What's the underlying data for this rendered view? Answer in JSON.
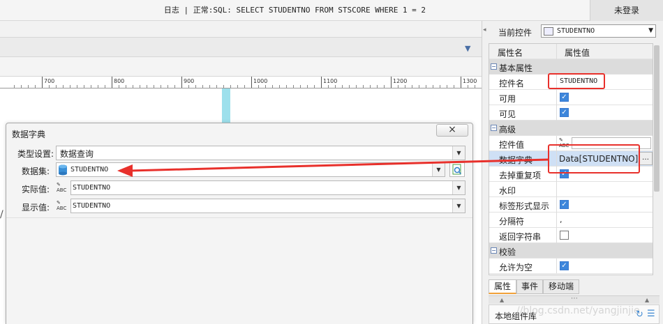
{
  "topbar": {
    "log": "日志 | 正常:SQL: SELECT STUDENTNO FROM STSCORE WHERE 1 = 2",
    "login": "未登录"
  },
  "ruler": {
    "labels": [
      "700",
      "800",
      "900",
      "1000",
      "1100",
      "1200",
      "1300"
    ]
  },
  "dialog": {
    "title": "数据字典",
    "close_icon": "close-icon",
    "type_label": "类型设置:",
    "type_value": "数据查询",
    "dataset_label": "数据集:",
    "dataset_value": "STUDENTNO",
    "actual_label": "实际值:",
    "actual_value": "STUDENTNO",
    "display_label": "显示值:",
    "display_value": "STUDENTNO"
  },
  "panel": {
    "current_label": "当前控件",
    "current_value": "STUDENTNO",
    "header_name": "属性名",
    "header_value": "属性值",
    "section_basic": "基本属性",
    "row_name_key": "控件名",
    "row_name_val": "STUDENTNO",
    "row_enabled": "可用",
    "row_visible": "可见",
    "section_advanced": "高级",
    "row_value": "控件值",
    "row_dict": "数据字典",
    "row_dict_val": "Data[STUDENTNO]]",
    "row_dedup": "去掉重复项",
    "row_watermark": "水印",
    "row_tag": "标签形式显示",
    "row_sep": "分隔符",
    "row_sep_val": ",",
    "row_return": "返回字符串",
    "section_check": "校验",
    "row_allow_empty": "允许为空",
    "checks": {
      "enabled": true,
      "visible": true,
      "dedup": true,
      "tag": true,
      "return": false,
      "allow_empty": true
    },
    "tabs": [
      "属性",
      "事件",
      "移动端"
    ],
    "splitter": "⋯",
    "local_lib": "本地组件库",
    "watermark": "//blog.csdn.net/yangjinjie"
  },
  "colors": {
    "annotation": "#e8302b",
    "check": "#3d86db"
  }
}
